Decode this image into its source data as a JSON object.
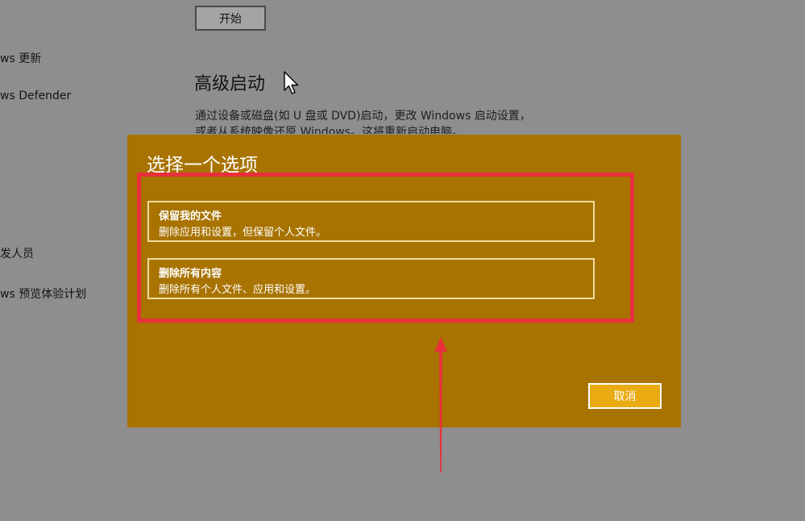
{
  "sidebar": {
    "items": [
      {
        "label": "ws 更新"
      },
      {
        "label": "ws Defender"
      },
      {
        "label": "发人员"
      },
      {
        "label": "ws 预览体验计划"
      }
    ]
  },
  "main": {
    "start_button_label": "开始",
    "advanced_startup": {
      "title": "高级启动",
      "description_line1": "通过设备或磁盘(如 U 盘或 DVD)启动，更改 Windows 启动设置，",
      "description_line2": "或者从系统映像还原 Windows。这将重新启动电脑。"
    }
  },
  "dialog": {
    "title": "选择一个选项",
    "options": [
      {
        "title": "保留我的文件",
        "description": "删除应用和设置，但保留个人文件。"
      },
      {
        "title": "删除所有内容",
        "description": "删除所有个人文件、应用和设置。"
      }
    ],
    "cancel_label": "取消"
  },
  "colors": {
    "overlay_gray": "#8e8e8e",
    "dialog_background": "#a87300",
    "cancel_button": "#e9aa12",
    "annotation_red": "#e8303c"
  },
  "icons": {
    "cursor": "mouse-pointer-icon",
    "annotation_arrow": "up-arrow-icon"
  }
}
